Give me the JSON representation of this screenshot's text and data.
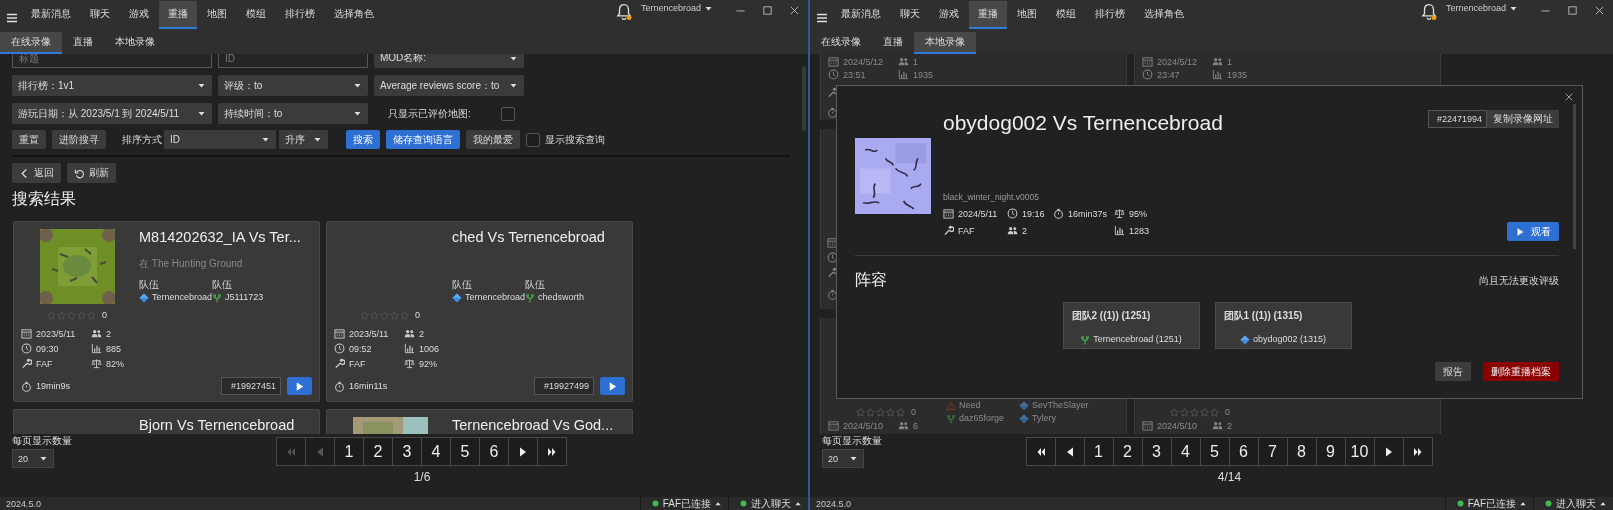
{
  "windows": [
    {
      "nav_tabs": [
        {
          "label": "最新消息",
          "selected": false
        },
        {
          "label": "聊天",
          "selected": false
        },
        {
          "label": "游戏",
          "selected": false
        },
        {
          "label": "重播",
          "selected": true
        },
        {
          "label": "地图",
          "selected": false
        },
        {
          "label": "模组",
          "selected": false
        },
        {
          "label": "排行榜",
          "selected": false
        },
        {
          "label": "选择角色",
          "selected": false
        }
      ],
      "username": "Ternencebroad",
      "sub_tabs": [
        {
          "label": "在线录像",
          "selected": true
        },
        {
          "label": "直播",
          "selected": false
        },
        {
          "label": "本地录像",
          "selected": false
        }
      ],
      "search": {
        "filter_rows": [
          [
            {
              "kind": "input",
              "placeholder": "标题"
            },
            {
              "kind": "input",
              "placeholder": "ID"
            },
            {
              "kind": "dropdown",
              "label": "MOD名称:"
            }
          ],
          [
            {
              "kind": "dropdown",
              "label": "排行榜：1v1"
            },
            {
              "kind": "dropdown",
              "label": "评级：to"
            },
            {
              "kind": "dropdown",
              "label": "Average reviews score：to"
            }
          ],
          [
            {
              "kind": "dropdown",
              "label": "游玩日期：从 2023/5/1 到 2024/5/11"
            },
            {
              "kind": "dropdown",
              "label": "持续时间：to"
            },
            {
              "kind": "checkbox",
              "label": "只显示已评价地图:",
              "checked": false
            }
          ]
        ],
        "actions": [
          {
            "kind": "button",
            "label": "重置",
            "primary": false
          },
          {
            "kind": "button",
            "label": "进阶搜寻",
            "primary": false
          },
          {
            "kind": "label",
            "label": "排序方式"
          },
          {
            "kind": "select",
            "label": "ID"
          },
          {
            "kind": "select",
            "label": "升序"
          },
          {
            "kind": "button",
            "label": "搜索",
            "primary": true
          },
          {
            "kind": "button",
            "label": "储存查询语言",
            "primary": true
          },
          {
            "kind": "button",
            "label": "我的最爱",
            "primary": false
          },
          {
            "kind": "checkbox",
            "label": "显示搜索查询",
            "checked": false
          }
        ],
        "toolbar": [
          {
            "kind": "back",
            "label": "返回"
          },
          {
            "kind": "refresh",
            "label": "刷新"
          }
        ],
        "heading": "搜索结果",
        "cards": [
          {
            "title": "M814202632_IA Vs Ter...",
            "map": "在 The Hunting Ground",
            "picture": {
              "kind": "picture"
            },
            "teams": [
              {
                "label": "队伍",
                "players": [
                  {
                    "name": "Ternencebroad",
                    "kind": "diamond"
                  }
                ]
              },
              {
                "label": "队伍",
                "players": [
                  {
                    "name": "J5111723",
                    "kind": "fork"
                  }
                ]
              }
            ],
            "stars": 0,
            "rating_count": "0",
            "date": "2023/5/11",
            "players": "2",
            "time": "09:30",
            "rating": "885",
            "mod": "FAF",
            "balance": "82%",
            "duration": "19min9s",
            "replay_id": "#19927451"
          },
          {
            "title": "ched Vs Ternencebroad",
            "teams": [
              {
                "label": "队伍",
                "players": [
                  {
                    "name": "Ternencebroad",
                    "kind": "diamond"
                  }
                ]
              },
              {
                "label": "队伍",
                "players": [
                  {
                    "name": "chedsworth",
                    "kind": "fork"
                  }
                ]
              }
            ],
            "stars": 0,
            "rating_count": "0",
            "date": "2023/5/11",
            "players": "2",
            "time": "09:52",
            "rating": "1006",
            "mod": "FAF",
            "balance": "92%",
            "duration": "16min11s",
            "replay_id": "#19927499"
          },
          {
            "title": "Bjorn Vs Ternencebroad"
          },
          {
            "title": "Ternencebroad Vs God...",
            "picture": {
              "kind": "picture"
            }
          }
        ]
      },
      "pagination": {
        "per_page_label": "每页显示数量",
        "per_page": "20",
        "buttons": [
          {
            "kind": "first",
            "disabled": true
          },
          {
            "kind": "prev",
            "disabled": true
          },
          {
            "kind": "page",
            "label": "1",
            "disabled": false
          },
          {
            "kind": "page",
            "label": "2",
            "disabled": false
          },
          {
            "kind": "page",
            "label": "3",
            "disabled": false
          },
          {
            "kind": "page",
            "label": "4",
            "disabled": false
          },
          {
            "kind": "page",
            "label": "5",
            "disabled": false
          },
          {
            "kind": "page",
            "label": "6",
            "disabled": false
          },
          {
            "kind": "next",
            "disabled": false
          },
          {
            "kind": "last",
            "disabled": false
          }
        ],
        "position": "1/6"
      },
      "status_bar": {
        "version": "2024.5.0",
        "items": [
          {
            "label": "FAF已连接"
          },
          {
            "label": "进入聊天"
          }
        ]
      }
    },
    {
      "nav_tabs": [
        {
          "label": "最新消息",
          "selected": false
        },
        {
          "label": "聊天",
          "selected": false
        },
        {
          "label": "游戏",
          "selected": false
        },
        {
          "label": "重播",
          "selected": true
        },
        {
          "label": "地图",
          "selected": false
        },
        {
          "label": "模组",
          "selected": false
        },
        {
          "label": "排行榜",
          "selected": false
        },
        {
          "label": "选择角色",
          "selected": false
        }
      ],
      "username": "Ternencebroad",
      "sub_tabs": [
        {
          "label": "在线录像",
          "selected": false
        },
        {
          "label": "直播",
          "selected": false
        },
        {
          "label": "本地录像",
          "selected": true
        }
      ],
      "background_cards": {
        "top": [
          {
            "date": "2024/5/12",
            "players": "1",
            "time": "23:51",
            "rating": "1935"
          },
          {
            "date": "2024/5/12",
            "players": "1",
            "time": "23:47",
            "rating": "1935"
          }
        ],
        "bottom": [
          {
            "teams": [
              {
                "players": [
                  {
                    "name": "Need",
                    "kind": "warning"
                  },
                  {
                    "name": "daz65forge",
                    "kind": "fork"
                  }
                ]
              },
              {
                "players": [
                  {
                    "name": "SevTheSlayer",
                    "kind": "diamond"
                  },
                  {
                    "name": "Tylery",
                    "kind": "diamond"
                  }
                ]
              }
            ],
            "stars": 0,
            "rating_count": "0",
            "date": "2024/5/10",
            "players": "6"
          },
          {
            "stars": 0,
            "rating_count": "0",
            "date": "2024/5/10",
            "players": "2"
          }
        ]
      },
      "replay_dialog": {
        "title": "obydog002 Vs Ternencebroad",
        "replay_id": "#22471994",
        "copy_button": "复制录像网址",
        "picture": {
          "kind": "picture"
        },
        "map": "black_winter_night.v0005",
        "date": "2024/5/11",
        "time": "19:16",
        "duration": "16min37s",
        "balance": "95%",
        "mod": "FAF",
        "players": "2",
        "rating": "1283",
        "watch_button": "观看",
        "lineup_heading": "阵容",
        "rating_note": "尚且无法更改评级",
        "teams": [
          {
            "name": "团队2 ((1))  (1251)",
            "players": [
              {
                "name": "Ternencebroad  (1251)",
                "kind": "fork"
              }
            ]
          },
          {
            "name": "团队1 ((1))  (1315)",
            "players": [
              {
                "name": "obydog002  (1315)",
                "kind": "diamond"
              }
            ]
          }
        ],
        "report_button": "报告",
        "delete_button": "删除重播档案"
      },
      "pagination": {
        "per_page_label": "每页显示数量",
        "per_page": "20",
        "buttons": [
          {
            "kind": "first",
            "disabled": false
          },
          {
            "kind": "prev",
            "disabled": false
          },
          {
            "kind": "page",
            "label": "1",
            "disabled": false
          },
          {
            "kind": "page",
            "label": "2",
            "disabled": false
          },
          {
            "kind": "page",
            "label": "3",
            "disabled": false
          },
          {
            "kind": "page",
            "label": "4",
            "disabled": false
          },
          {
            "kind": "page",
            "label": "5",
            "disabled": false
          },
          {
            "kind": "page",
            "label": "6",
            "disabled": false
          },
          {
            "kind": "page",
            "label": "7",
            "disabled": false
          },
          {
            "kind": "page",
            "label": "8",
            "disabled": false
          },
          {
            "kind": "page",
            "label": "9",
            "disabled": false
          },
          {
            "kind": "page",
            "label": "10",
            "disabled": false
          },
          {
            "kind": "next",
            "disabled": false
          },
          {
            "kind": "last",
            "disabled": false
          }
        ],
        "position": "4/14"
      },
      "status_bar": {
        "version": "2024.5.0",
        "items": [
          {
            "label": "FAF已连接"
          },
          {
            "label": "进入聊天"
          }
        ]
      }
    }
  ]
}
